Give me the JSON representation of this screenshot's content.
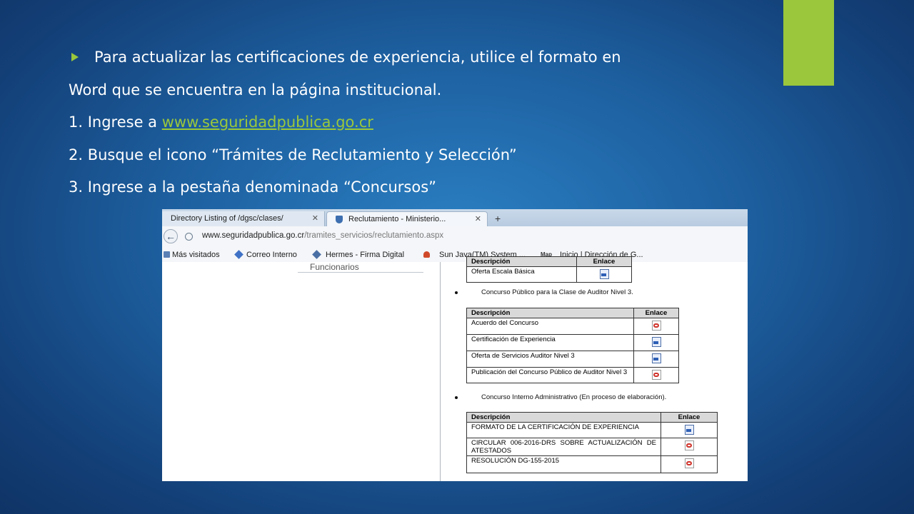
{
  "slide": {
    "lines": [
      "Para actualizar las certificaciones de experiencia, utilice el formato en",
      "Word que se encuentra en la página institucional.",
      "1. Ingrese a ",
      "2. Busque el icono “Trámites de Reclutamiento y Selección”",
      "3. Ingrese a la pestaña denominada “Concursos”"
    ],
    "link": "www.seguridadpublica.go.cr",
    "colors": {
      "accent": "#9ac73b",
      "background": "#1d5f9f"
    }
  },
  "browser": {
    "tabs": [
      {
        "label": "Directory Listing of /dgsc/clases/"
      },
      {
        "label": "Reclutamiento - Ministerio..."
      }
    ],
    "new_tab": "+",
    "url_host": "www.seguridadpublica.go.cr",
    "url_path": "/tramites_servicios/reclutamiento.aspx",
    "bookmarks": [
      "Más visitados",
      "Correo Interno",
      "Hermes - Firma Digital",
      "Sun Java(TM) System ...",
      "Inicio | Dirección de G..."
    ],
    "bookmark_badge": "Map"
  },
  "page": {
    "sidebar_label": "Funcionarios",
    "table0": {
      "header_desc": "Descripción",
      "header_link": "Enlace",
      "rows": [
        {
          "desc": "Oferta Escala Básica",
          "icon": "word-icon"
        }
      ]
    },
    "bullet1": "Concurso Público para la Clase de Auditor Nivel 3.",
    "table1": {
      "header_desc": "Descripción",
      "header_link": "Enlace",
      "rows": [
        {
          "desc": "Acuerdo del Concurso",
          "icon": "pdf-icon"
        },
        {
          "desc": "Certificación de Experiencia",
          "icon": "word-icon"
        },
        {
          "desc": "Oferta de Servicios Auditor Nivel 3",
          "icon": "word-icon"
        },
        {
          "desc": "Publicación del Concurso Público de Auditor Nivel 3",
          "icon": "pdf-icon"
        }
      ]
    },
    "bullet2": "Concurso Interno Administrativo (En proceso de elaboración).",
    "table2": {
      "header_desc": "Descripción",
      "header_link": "Enlace",
      "rows": [
        {
          "desc": "FORMATO DE LA CERTIFICACIÓN DE EXPERIENCIA",
          "icon": "word-icon"
        },
        {
          "desc": "CIRCULAR 006-2016-DRS SOBRE ACTUALIZACIÓN DE ATESTADOS",
          "icon": "pdf-icon"
        },
        {
          "desc": "RESOLUCIÓN DG-155-2015",
          "icon": "pdf-icon"
        }
      ]
    }
  }
}
